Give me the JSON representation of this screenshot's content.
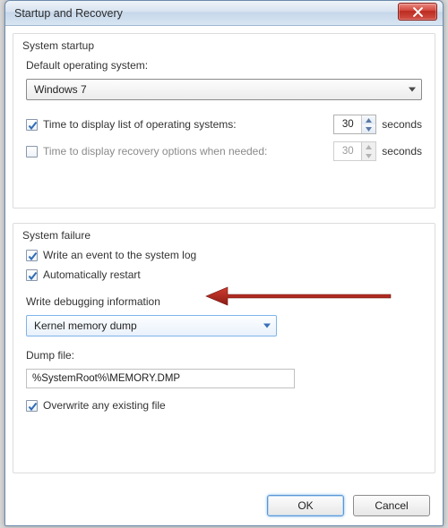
{
  "window": {
    "title": "Startup and Recovery"
  },
  "groups": {
    "startup": {
      "label": "System startup",
      "default_os_label": "Default operating system:",
      "default_os_value": "Windows 7",
      "display_os_list_label": "Time to display list of operating systems:",
      "display_os_list_checked": true,
      "display_os_list_value": "30",
      "display_recovery_label": "Time to display recovery options when needed:",
      "display_recovery_checked": false,
      "display_recovery_value": "30",
      "seconds": "seconds"
    },
    "failure": {
      "label": "System failure",
      "write_event_label": "Write an event to the system log",
      "write_event_checked": true,
      "auto_restart_label": "Automatically restart",
      "auto_restart_checked": true,
      "write_debug_label": "Write debugging information",
      "dump_type": "Kernel memory dump",
      "dump_file_label": "Dump file:",
      "dump_file_value": "%SystemRoot%\\MEMORY.DMP",
      "overwrite_label": "Overwrite any existing file",
      "overwrite_checked": true
    }
  },
  "buttons": {
    "ok": "OK",
    "cancel": "Cancel"
  }
}
